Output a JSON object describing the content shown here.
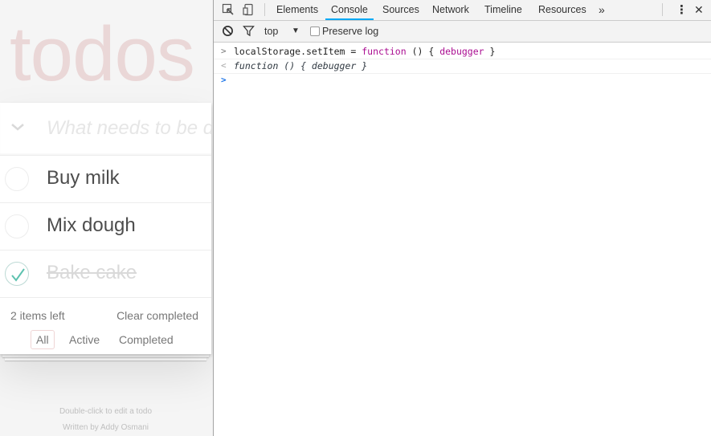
{
  "app": {
    "title": "todos",
    "new_todo_placeholder": "What needs to be done?",
    "toggle_all_glyph": "❯",
    "todos": [
      {
        "label": "Buy milk",
        "completed": false
      },
      {
        "label": "Mix dough",
        "completed": false
      },
      {
        "label": "Bake cake",
        "completed": true
      }
    ],
    "items_left": "2 items left",
    "clear_completed": "Clear completed",
    "filters": [
      "All",
      "Active",
      "Completed"
    ],
    "selected_filter": "All",
    "info": {
      "line1": "Double-click to edit a todo",
      "line2": "Written by Addy Osmani"
    },
    "colors": {
      "title": "#eadcdc",
      "check": "#5dc2af",
      "selected_filter_border": "#efd6d6"
    }
  },
  "devtools": {
    "tabs": [
      "Elements",
      "Console",
      "Sources",
      "Network",
      "Timeline",
      "Resources"
    ],
    "active_tab": "Console",
    "more_tabs_glyph": "»",
    "menu_glyph": "⋮",
    "close_glyph": "✕",
    "toolbar": {
      "context": "top",
      "context_arrow": "▼",
      "preserve_log_label": "Preserve log",
      "preserve_log_checked": false
    },
    "console": {
      "input_prefix": ">",
      "output_prefix": "<",
      "prompt_prefix": ">",
      "command": {
        "part1": "localStorage.setItem = ",
        "kw1": "function",
        "part2": " () { ",
        "kw2": "debugger",
        "part3": " }"
      },
      "result": "function () { debugger }"
    },
    "colors": {
      "active_tab_underline": "#03a9f4",
      "keyword": "#aa0d91",
      "prompt": "#1a73e8"
    }
  }
}
